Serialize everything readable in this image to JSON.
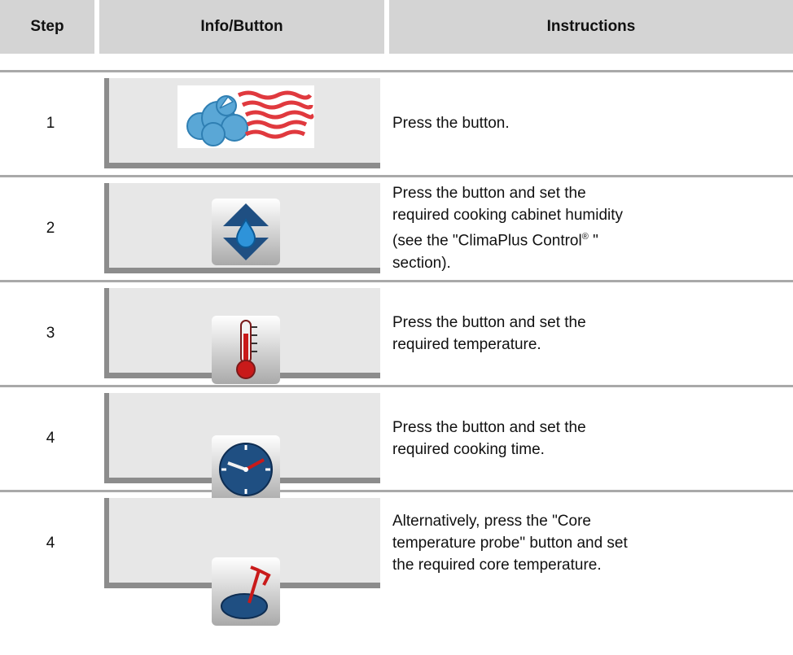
{
  "header": {
    "step": "Step",
    "info_button": "Info/Button",
    "instructions": "Instructions"
  },
  "rows": [
    {
      "step": "1",
      "icon": "steam-mode-icon",
      "instruction": "Press the button."
    },
    {
      "step": "2",
      "icon": "humidity-icon",
      "instruction_before": "Press the button and set the required cooking cabinet humidity (see the \"ClimaPlus Control",
      "instruction_mark": "®",
      "instruction_after": " \" section)."
    },
    {
      "step": "3",
      "icon": "thermometer-icon",
      "instruction": "Press the button and set the required temperature."
    },
    {
      "step": "4",
      "icon": "clock-icon",
      "instruction": "Press the button and set the required cooking time."
    },
    {
      "step": "4",
      "icon": "core-probe-icon",
      "instruction": "Alternatively, press the \"Core temperature probe\" button and set the required core temperature."
    }
  ]
}
